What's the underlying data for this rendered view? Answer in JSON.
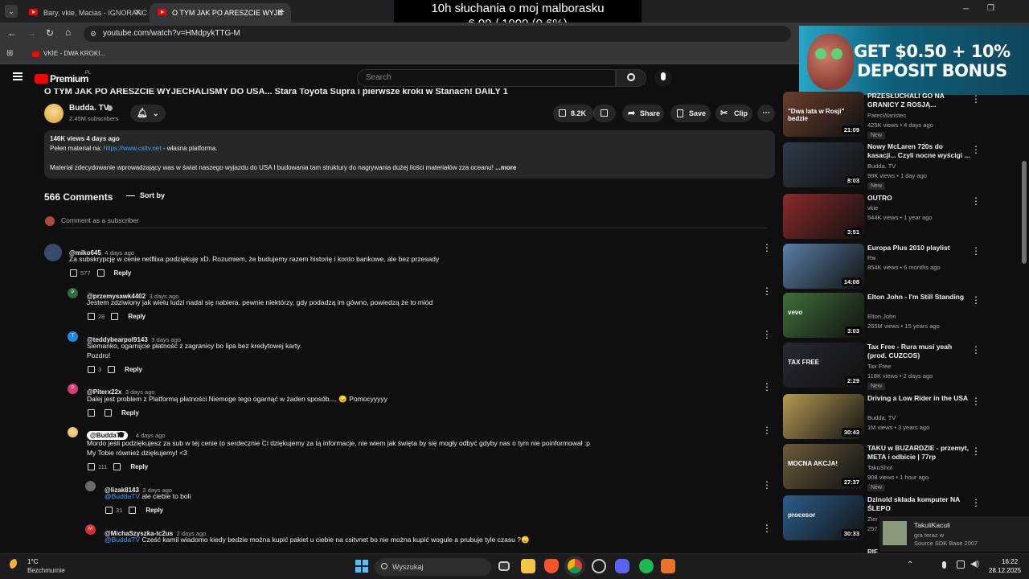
{
  "browser": {
    "tabs": [
      {
        "label": "Bary, vkie, Macias - IGNORANC"
      },
      {
        "label": "O TYM JAK PO ARESZCIE WYJE"
      }
    ],
    "url": "youtube.com/watch?v=HMdpykTTG-M",
    "bookmark": "VKIE - DWA KROKI..."
  },
  "overlay": {
    "line1": "10h słuchania o moj malborasku",
    "line2": "6.00 / 1000 (0.6%)"
  },
  "ad": {
    "line1": "GET $0.50 + 10%",
    "line2": "DEPOSIT BONUS"
  },
  "youtube": {
    "logo": "Premium",
    "logo_sup": "PL",
    "search_placeholder": "Search",
    "video_title": "O TYM JAK PO ARESZCIE WYJECHALIŚMY DO USA... Stara Toyota Supra i pierwsze kroki w Stanach! DAILY 1",
    "channel": {
      "name": "Budda. TV",
      "subs": "2.45M subscribers"
    },
    "actions": {
      "likes": "8.2K",
      "share": "Share",
      "save": "Save",
      "clip": "Clip"
    },
    "description": {
      "meta": "146K views  4 days ago",
      "line1_prefix": "Pełen materiał na: ",
      "line1_link": "https://www.csitv.net",
      "line1_suffix": " - własna platforma.",
      "line2": "Materiał zdecydowanie wprowadzający was w świat naszego wyjazdu do USA I budowania tam struktury do nagrywania dużej ilości materiałów zza oceanu!",
      "more": "...more"
    },
    "comments_header": {
      "count": "566 Comments",
      "sort": "Sort by",
      "add": "Comment as a subscriber"
    },
    "comments": [
      {
        "author": "@miko645",
        "time": "4 days ago",
        "text": "Za subskrypcję w cenie netflixa podziękuję xD. Rozumiem, że budujemy razem historię i konto bankowe, ale bez przesady",
        "likes": "577",
        "reply": "Reply"
      },
      {
        "author": "@przemysawk4402",
        "time": "3 days ago",
        "text": "Jestem zdziwiony jak wielu ludzi nadal się nabiera. pewnie niektórzy, gdy podadzą im gówno, powiedzą że to miód",
        "likes": "28",
        "reply": "Reply"
      },
      {
        "author": "@teddybearpol9143",
        "time": "3 days ago",
        "text": "Siemanko, ogarnijcie płatność z zagranicy bo lipa bez kredytowej karty.",
        "text2": "Pozdro!",
        "likes": "3",
        "reply": "Reply"
      },
      {
        "author": "@Piterx22x",
        "time": "3 days ago",
        "text": "Dalej jest problem z Platformą płatności Niemoge tego ogarnąć w żaden sposób.... 😞 Pomocyyyyy",
        "likes": "",
        "reply": "Reply"
      },
      {
        "author": "@BuddaTV",
        "time": "4 days ago",
        "text": "Mordo jeśli podziękujesz za sub w tej cenie to serdecznie Ci dziękujemy za tą informacje, nie wiem jak święta by się mogły odbyć gdyby nas o tym nie poinformował :p",
        "text2": "My Tobie również dziękujemy! <3",
        "likes": "111",
        "reply": "Reply"
      },
      {
        "author": "@lizak8143",
        "time": "2 days ago",
        "mention": "@BuddaTV",
        "text": " ale ciebie to boli",
        "likes": "31",
        "reply": "Reply"
      },
      {
        "author": "@MichaSzyszka-tc2us",
        "time": "2 days ago",
        "mention": "@BuddaTV",
        "text": " Cześć kamil wiadomo kiedy bedzie można kupić pakiet u ciebie na csitvnet bo nie można kupić wogule a prubuje tyle czasu ?😞",
        "likes": "",
        "reply": "Reply"
      }
    ],
    "sidebar": [
      {
        "title": "PRZESŁUCHALI GO NA GRANICY Z ROSJĄ...",
        "thumb_text": "\"Dwa lata w Rosji\" bedzie",
        "channel": "PatecWaristec",
        "meta": "425K views • 4 days ago",
        "badge": "New",
        "duration": "21:09",
        "color": "#6a3e2e"
      },
      {
        "title": "Nowy McLaren 720s do kasacji... Czyli nocne wyścigi ...",
        "channel": "Budda. TV",
        "meta": "98K views • 1 day ago",
        "badge": "New",
        "duration": "8:03",
        "color": "#2d3b4a"
      },
      {
        "title": "OUTRO",
        "channel": "vkie",
        "meta": "544K views • 1 year ago",
        "duration": "3:51",
        "color": "#8a2a2a"
      },
      {
        "title": "Europa Plus 2010 playlist",
        "channel": "Rж",
        "meta": "854K views • 6 months ago",
        "duration": "14:08",
        "color": "#5a7fa8"
      },
      {
        "title": "Elton John - I'm Still Standing",
        "channel": "Elton John",
        "meta": "265M views • 15 years ago",
        "duration": "3:03",
        "thumb_text": "vevo",
        "color": "#3f6f3a"
      },
      {
        "title": "Tax Free - Rura musi yeah (prod. CUZCOS)",
        "channel": "Tax Free",
        "meta": "118K views • 2 days ago",
        "badge": "New",
        "duration": "2:29",
        "thumb_text": "TAX FREE",
        "color": "#242a33"
      },
      {
        "title": "Driving a Low Rider in the USA",
        "channel": "Budda. TV",
        "meta": "1M views • 3 years ago",
        "duration": "30:43",
        "color": "#b59b52"
      },
      {
        "title": "TAKU w BUZARDZIE - przemyt, META i odbicie | 77rp",
        "channel": "TakuShot",
        "meta": "908 views • 1 hour ago",
        "badge": "New",
        "duration": "27:37",
        "thumb_text": "MOCNA AKCJA!",
        "color": "#6a5a3a"
      },
      {
        "title": "Dzinold składa komputer NA ŚLEPO",
        "channel": "Zier",
        "meta": "257",
        "duration": "30:33",
        "thumb_text": "procesor",
        "color": "#2d5e8c"
      }
    ],
    "sidebar_more": "RIF"
  },
  "notification": {
    "name": "TakuliKaculi",
    "status": "gra teraz w",
    "game": "Source SDK Base 2007"
  },
  "taskbar": {
    "weather_temp": "1°C",
    "weather_desc": "Bezchmurnie",
    "search": "Wyszukaj",
    "time": "16:22",
    "date": "28.12.2025"
  }
}
